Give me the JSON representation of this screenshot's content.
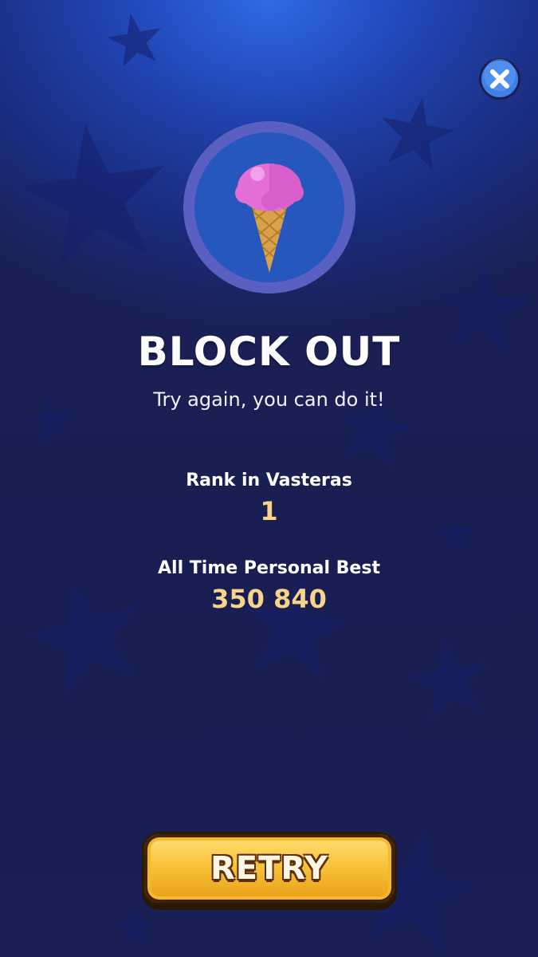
{
  "screen": {
    "title": "BLOCK OUT",
    "subtitle": "Try again, you can do it!"
  },
  "stats": {
    "rank_label": "Rank in Vasteras",
    "rank_value": "1",
    "best_label": "All Time Personal Best",
    "best_value": "350 840"
  },
  "buttons": {
    "retry_label": "RETRY",
    "close_icon": "close-icon"
  },
  "emblem": {
    "icon": "ice-cream-cone-icon"
  },
  "colors": {
    "background_top": "#2f6ae6",
    "background_bottom": "#1c2157",
    "value_gold": "#f7d48a",
    "retry_button": "#f8c33a",
    "scoop_pink": "#e36fd6"
  }
}
